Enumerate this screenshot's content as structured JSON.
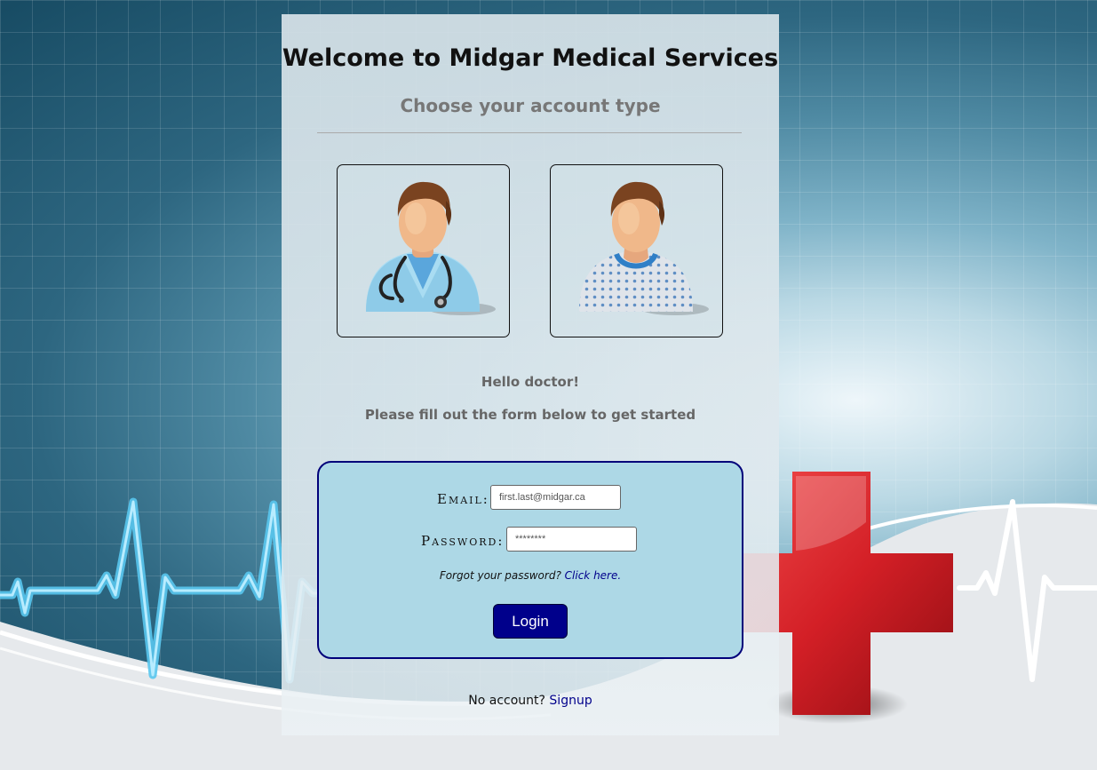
{
  "page": {
    "title": "Welcome to Midgar Medical Services",
    "subtitle": "Choose your account type"
  },
  "account_types": [
    {
      "name": "doctor",
      "icon": "doctor-avatar-icon"
    },
    {
      "name": "patient",
      "icon": "patient-avatar-icon"
    }
  ],
  "greeting": "Hello doctor!",
  "instructions": "Please fill out the form below to get started",
  "form": {
    "email_label": "Email:",
    "email_placeholder": "first.last@midgar.ca",
    "password_label": "Password:",
    "password_placeholder": "********",
    "forgot_text": "Forgot your password?",
    "forgot_link": "Click here.",
    "login_label": "Login"
  },
  "signup": {
    "prompt": "No account?",
    "link": "Signup"
  },
  "colors": {
    "form_background": "#add8e6",
    "form_border": "#00007a",
    "button": "#00008b",
    "link": "#00008b",
    "cross": "#d31f26"
  }
}
